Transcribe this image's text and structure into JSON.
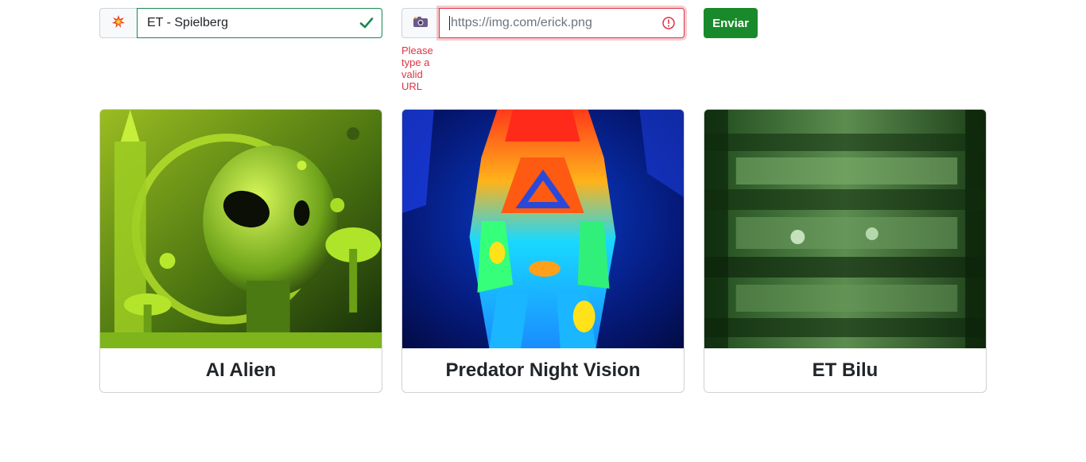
{
  "form": {
    "title_field": {
      "icon": "collision-icon",
      "value": "ET - Spielberg",
      "status": "valid"
    },
    "url_field": {
      "icon": "camera-icon",
      "placeholder": "https://img.com/erick.png",
      "value": "",
      "status": "invalid",
      "error": "Please type a valid URL"
    },
    "submit_label": "Enviar"
  },
  "cards": [
    {
      "title": "AI Alien"
    },
    {
      "title": "Predator Night Vision"
    },
    {
      "title": "ET Bilu"
    }
  ],
  "colors": {
    "valid": "#198754",
    "invalid": "#dc3545",
    "button": "#198a2b"
  }
}
